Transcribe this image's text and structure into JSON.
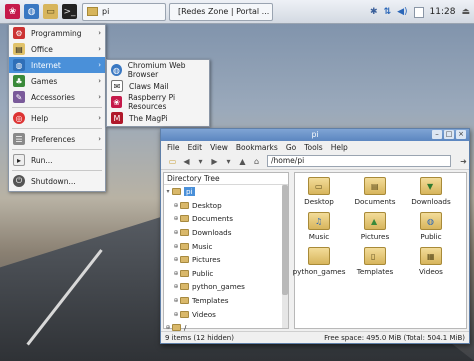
{
  "taskbar": {
    "task1_label": "pi",
    "task2_label": "[Redes Zone | Portal ...",
    "clock": "11:28"
  },
  "start_menu": {
    "items": [
      {
        "label": "Programming"
      },
      {
        "label": "Office"
      },
      {
        "label": "Internet"
      },
      {
        "label": "Games"
      },
      {
        "label": "Accessories"
      },
      {
        "label": "Help"
      },
      {
        "label": "Preferences"
      },
      {
        "label": "Run..."
      },
      {
        "label": "Shutdown..."
      }
    ]
  },
  "internet_submenu": {
    "items": [
      {
        "label": "Chromium Web Browser"
      },
      {
        "label": "Claws Mail"
      },
      {
        "label": "Raspberry Pi Resources"
      },
      {
        "label": "The MagPi"
      }
    ]
  },
  "file_manager": {
    "title": "pi",
    "menubar": [
      "File",
      "Edit",
      "View",
      "Bookmarks",
      "Go",
      "Tools",
      "Help"
    ],
    "path": "/home/pi",
    "tree_header": "Directory Tree",
    "tree": [
      {
        "label": "pi"
      },
      {
        "label": "Desktop"
      },
      {
        "label": "Documents"
      },
      {
        "label": "Downloads"
      },
      {
        "label": "Music"
      },
      {
        "label": "Pictures"
      },
      {
        "label": "Public"
      },
      {
        "label": "python_games"
      },
      {
        "label": "Templates"
      },
      {
        "label": "Videos"
      },
      {
        "label": "/"
      }
    ],
    "files": [
      {
        "label": "Desktop"
      },
      {
        "label": "Documents"
      },
      {
        "label": "Downloads"
      },
      {
        "label": "Music"
      },
      {
        "label": "Pictures"
      },
      {
        "label": "Public"
      },
      {
        "label": "python_games"
      },
      {
        "label": "Templates"
      },
      {
        "label": "Videos"
      }
    ],
    "status_left": "9 items (12 hidden)",
    "status_right": "Free space: 495.0 MiB (Total: 504.1 MiB)"
  }
}
